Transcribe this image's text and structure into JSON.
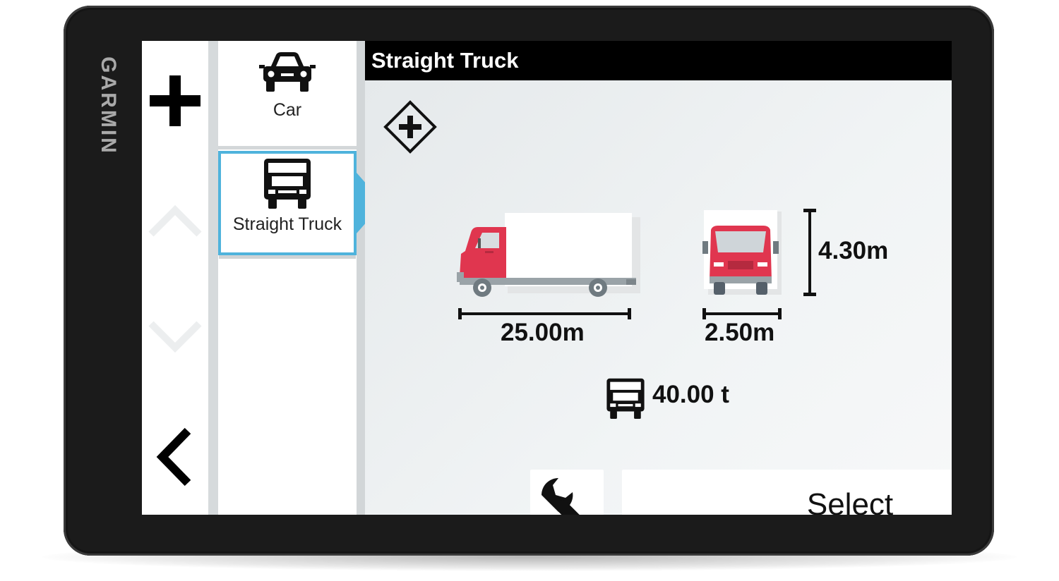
{
  "device": {
    "brand": "GARMIN",
    "colors": {
      "bezel": "#1b1b1b",
      "accent": "#4fb3dc",
      "truck_red": "#e0364f"
    }
  },
  "rail": {
    "icons": [
      "plus-icon",
      "chevron-up-icon",
      "chevron-down-icon",
      "back-arrow-icon"
    ]
  },
  "profiles": [
    {
      "label": "Car",
      "icon": "car-icon",
      "selected": false
    },
    {
      "label": "Straight Truck",
      "icon": "straight-truck-icon",
      "selected": true
    }
  ],
  "detail": {
    "title": "Straight Truck",
    "length": "25.00m",
    "width": "2.50m",
    "height": "4.30m",
    "weight": "40.00 t",
    "restriction_value": "-",
    "select_label": "Select"
  }
}
